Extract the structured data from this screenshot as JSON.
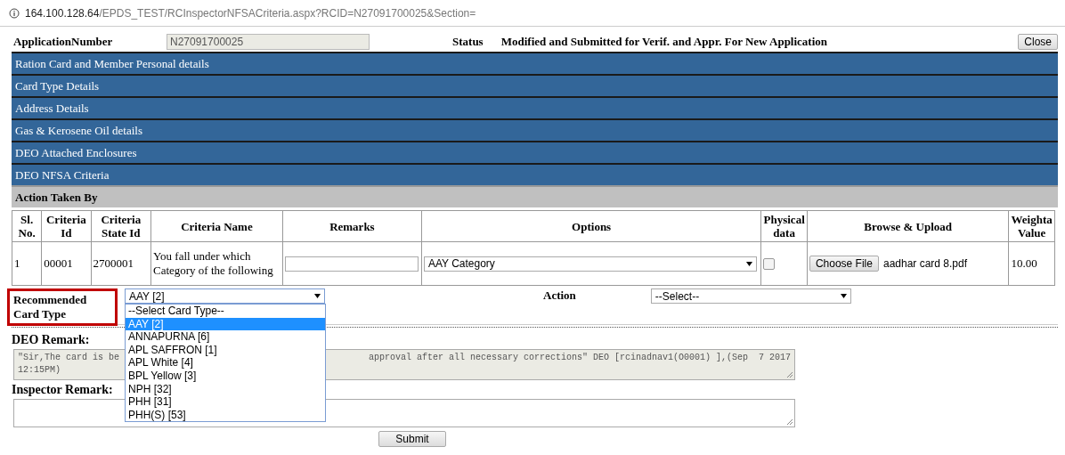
{
  "address_bar": {
    "host": "164.100.128.64",
    "path": "/EPDS_TEST/RCInspectorNFSACriteria.aspx?RCID=N27091700025&Section="
  },
  "header": {
    "application_number_label": "ApplicationNumber",
    "application_number": "N27091700025",
    "status_label": "Status",
    "status": "Modified and Submitted for Verif. and Appr. For New Application",
    "close_button": "Close"
  },
  "sections": [
    {
      "label": "Ration Card and Member Personal details",
      "kind": "collapsed"
    },
    {
      "label": "Card Type Details",
      "kind": "collapsed"
    },
    {
      "label": "Address Details",
      "kind": "collapsed"
    },
    {
      "label": "Gas & Kerosene Oil details",
      "kind": "collapsed"
    },
    {
      "label": "DEO Attached Enclosures",
      "kind": "collapsed"
    },
    {
      "label": "DEO NFSA Criteria",
      "kind": "collapsed"
    },
    {
      "label": "Action Taken By",
      "kind": "open"
    }
  ],
  "criteria_table": {
    "columns": [
      "Sl. No.",
      "Criteria Id",
      "Criteria State Id",
      "Criteria Name",
      "Remarks",
      "Options",
      "Physical data",
      "Browse & Upload",
      "Weighta Value"
    ],
    "rows": [
      {
        "sl_no": "1",
        "criteria_id": "00001",
        "criteria_state_id": "2700001",
        "criteria_name": "You fall under which Category of the following",
        "option": "AAY Category",
        "physical_data_checked": false,
        "file_button": "Choose File",
        "file_name": "aadhar card 8.pdf",
        "weightage_value": "10.00"
      }
    ]
  },
  "recommended_card_type": {
    "label": "Recommended Card Type",
    "value": "AAY [2]",
    "expanded": true,
    "options": [
      {
        "label": "--Select Card Type--",
        "selected": false
      },
      {
        "label": "AAY [2]",
        "selected": true
      },
      {
        "label": "ANNAPURNA [6]",
        "selected": false
      },
      {
        "label": "APL SAFFRON [1]",
        "selected": false
      },
      {
        "label": "APL White [4]",
        "selected": false
      },
      {
        "label": "BPL Yellow [3]",
        "selected": false
      },
      {
        "label": "NPH [32]",
        "selected": false
      },
      {
        "label": "PHH [31]",
        "selected": false
      },
      {
        "label": "PHH(S) [53]",
        "selected": false
      }
    ]
  },
  "action": {
    "label": "Action",
    "value": "--Select--"
  },
  "deo_remark": {
    "label": "DEO Remark:",
    "visible_text": [
      "\"Sir,The card is be",
      "approval after all necessary corrections\" DEO [rcinadnav1(O0001) ],(Sep  7 2017",
      "12:15PM)"
    ]
  },
  "inspector_remark": {
    "label": "Inspector Remark:"
  },
  "submit_button": "Submit"
}
